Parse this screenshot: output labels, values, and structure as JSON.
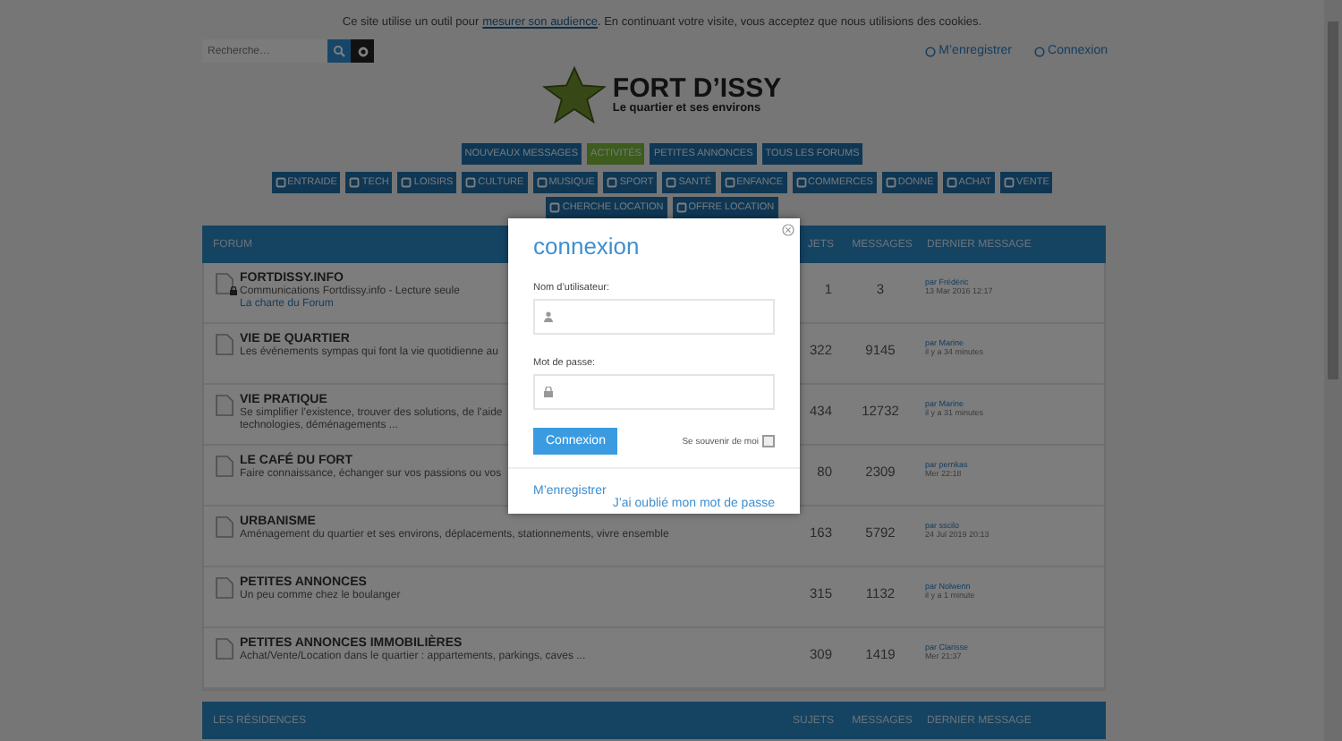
{
  "cookie_notice": {
    "before": "Ce site utilise un outil pour",
    "link": "mesurer son audience",
    "after": ". En continuant votre visite, vous acceptez que nous utilisions des cookies."
  },
  "search": {
    "placeholder": "Recherche…"
  },
  "user_links": [
    "M’enregistrer",
    "Connexion"
  ],
  "logo": {
    "title": "FORT D’ISSY",
    "subtitle": "Le quartier et ses environs"
  },
  "nav": [
    {
      "label": "NOUVEAUX MESSAGES",
      "selected": false
    },
    {
      "label": "ACTIVITÉS",
      "selected": true
    },
    {
      "label": "PETITES ANNONCES",
      "selected": false
    },
    {
      "label": "TOUS LES FORUMS",
      "selected": false
    }
  ],
  "categories": [
    "ENTRAIDE",
    "TECH",
    "LOISIRS",
    "CULTURE",
    "MUSIQUE",
    "SPORT",
    "SANTÉ",
    "ENFANCE",
    "COMMERCES",
    "DONNE",
    "ACHAT",
    "VENTE",
    "CHERCHE LOCATION",
    "OFFRE LOCATION"
  ],
  "forum_sections": [
    {
      "columns": [
        "FORUM",
        "JETS",
        "MESSAGES",
        "DERNIER MESSAGE"
      ],
      "rows": [
        {
          "title": "FORTDISSY.INFO",
          "description": [
            "Communications Fortdissy.info - Lecture seule"
          ],
          "link": "La charte du Forum",
          "locked": true,
          "topics": "1",
          "posts": "3",
          "last_by": "par Frédéric",
          "last_time": "13 Mar 2016 12:17"
        },
        {
          "title": "VIE DE QUARTIER",
          "description": [
            "Les événements sympas qui font la vie quotidienne au"
          ],
          "locked": false,
          "topics": "322",
          "posts": "9145",
          "last_by": "par Marine",
          "last_time": "il y a 34 minutes"
        },
        {
          "title": "VIE PRATIQUE",
          "description": [
            "Se simplifier l’existence, trouver des solutions, de l’aide",
            "technologies, déménagements ..."
          ],
          "locked": false,
          "topics": "434",
          "posts": "12732",
          "last_by": "par Marine",
          "last_time": "il y a 31 minutes"
        },
        {
          "title": "LE CAFÉ DU FORT",
          "description": [
            "Faire connaissance, échanger sur vos passions ou vos"
          ],
          "locked": false,
          "topics": "80",
          "posts": "2309",
          "last_by": "par pernkas",
          "last_time": "Mer 22:18"
        },
        {
          "title": "URBANISME",
          "description": [
            "Aménagement du quartier et ses environs, déplacements, stationnements, vivre ensemble"
          ],
          "locked": false,
          "topics": "163",
          "posts": "5792",
          "last_by": "par sscilo",
          "last_time": "24 Jul 2019 20:13"
        },
        {
          "title": "PETITES ANNONCES",
          "description": [
            "Un peu comme chez le boulanger"
          ],
          "locked": false,
          "topics": "315",
          "posts": "1132",
          "last_by": "par Nolwenn",
          "last_time": "il y a 1 minute"
        },
        {
          "title": "PETITES ANNONCES IMMOBILIÈRES",
          "description": [
            "Achat/Vente/Location dans le quartier : appartements, parkings, caves ..."
          ],
          "locked": false,
          "topics": "309",
          "posts": "1419",
          "last_by": "par Clarisse",
          "last_time": "Mer 21:37"
        }
      ]
    },
    {
      "columns": [
        "LES RÉSIDENCES",
        "SUJETS",
        "MESSAGES",
        "DERNIER MESSAGE"
      ]
    }
  ],
  "login": {
    "title": "connexion",
    "username_label": "Nom d’utilisateur:",
    "password_label": "Mot de passe:",
    "submit": "Connexion",
    "remember": {
      "label": "Se souvenir de moi",
      "checked": false
    },
    "register": "M’enregistrer",
    "forgot": "J’ai oublié mon mot de passe"
  }
}
